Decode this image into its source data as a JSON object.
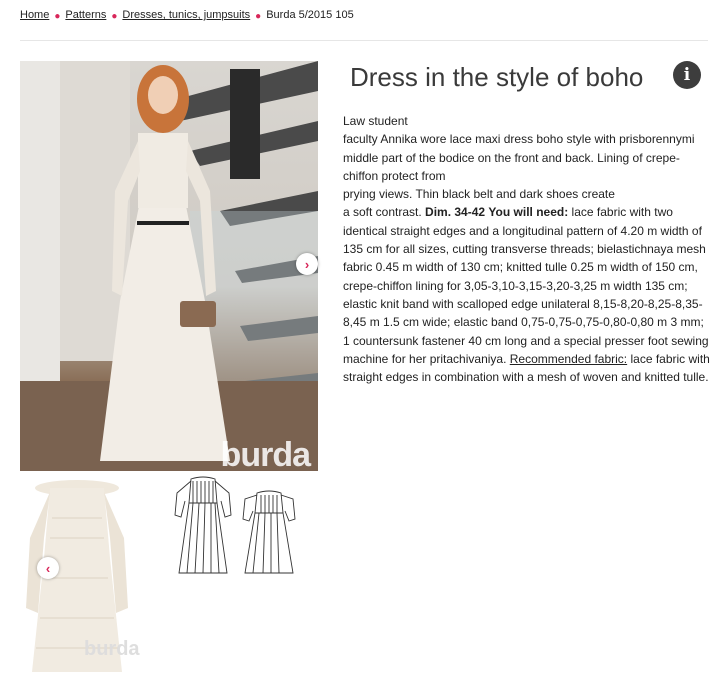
{
  "breadcrumb": {
    "items": [
      "Home",
      "Patterns",
      "Dresses, tunics, jumpsuits"
    ],
    "current": "Burda 5/2015 105"
  },
  "product": {
    "title": "Dress in the style of boho",
    "info_icon": "info-icon",
    "description": {
      "line1": "Law student",
      "line2": "faculty Annika wore lace maxi dress boho style with prisborennymi middle part of the bodice on the front and back. Lining of crepe-chiffon protect from",
      "line3": "prying views. Thin black belt and dark shoes create",
      "line4_start": "a soft contrast. ",
      "dim_label": "Dim. 34-42",
      "need_label": "You will need:",
      "materials": " lace fabric with two identical straight edges and a longitudinal pattern of 4.20 m width of 135 cm for all sizes, cutting transverse threads; bielastichnaya mesh fabric 0.45 m width of 130 cm; knitted tulle 0.25 m width of 150 cm, crepe-chiffon lining for 3,05-3,10-3,15-3,20-3,25 m width 135 cm; elastic knit band with scalloped edge unilateral 8,15-8,20-8,25-8,35-8,45 m 1.5 cm wide; elastic band 0,75-0,75-0,75-0,80-0,80 m 3 mm; 1 countersunk fastener 40 cm long and a special presser foot sewing machine for her pritachivaniya. ",
      "recommended_label": "Recommended fabric:",
      "recommended": " lace fabric with straight edges in combination with a mesh of woven and knitted tulle."
    }
  },
  "gallery": {
    "watermark": "burda",
    "thumb_watermark": "burda",
    "next_icon": "chevron-right-icon",
    "prev_icon": "chevron-left-icon",
    "next_glyph": "›",
    "prev_glyph": "‹"
  },
  "colors": {
    "accent": "#d8275a",
    "icon_bg": "#3d3d3d"
  }
}
